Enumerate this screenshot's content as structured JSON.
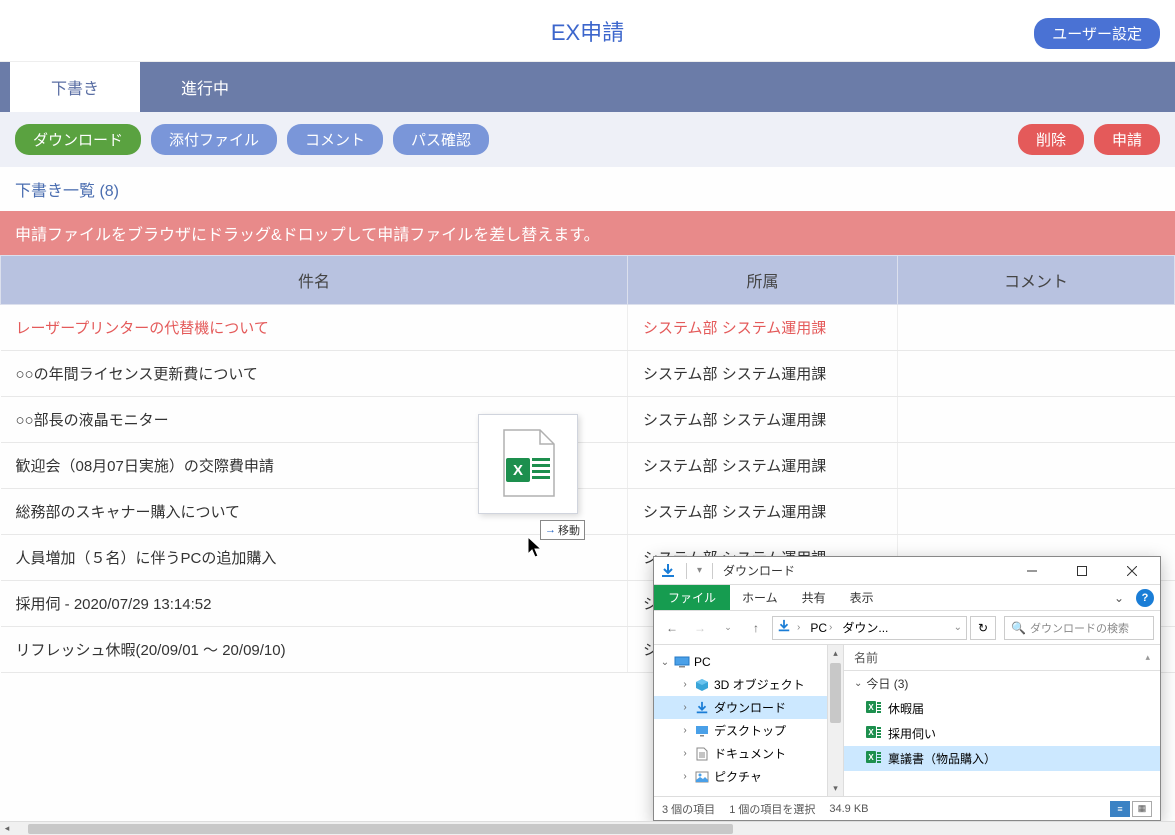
{
  "header": {
    "title": "EX申請",
    "user_settings": "ユーザー設定"
  },
  "tabs": {
    "draft": "下書き",
    "in_progress": "進行中"
  },
  "toolbar": {
    "download": "ダウンロード",
    "attachment": "添付ファイル",
    "comment": "コメント",
    "path_check": "パス確認",
    "delete": "削除",
    "apply": "申請"
  },
  "list_title": "下書き一覧 (8)",
  "banner": "申請ファイルをブラウザにドラッグ&ドロップして申請ファイルを差し替えます。",
  "columns": {
    "subject": "件名",
    "dept": "所属",
    "comment": "コメント"
  },
  "rows": [
    {
      "subject": "レーザープリンターの代替機について",
      "dept": "システム部 システム運用課",
      "comment": "",
      "highlighted": true
    },
    {
      "subject": "○○の年間ライセンス更新費について",
      "dept": "システム部 システム運用課",
      "comment": ""
    },
    {
      "subject": "○○部長の液晶モニター",
      "dept": "システム部 システム運用課",
      "comment": ""
    },
    {
      "subject": "歓迎会（08月07日実施）の交際費申請",
      "dept": "システム部 システム運用課",
      "comment": ""
    },
    {
      "subject": "総務部のスキャナー購入について",
      "dept": "システム部 システム運用課",
      "comment": ""
    },
    {
      "subject": "人員増加（５名）に伴うPCの追加購入",
      "dept": "システム部 システム運用課",
      "comment": ""
    },
    {
      "subject": "採用伺 - 2020/07/29 13:14:52",
      "dept": "シ",
      "comment": ""
    },
    {
      "subject": "リフレッシュ休暇(20/09/01 ～ 20/09/10)",
      "dept": "シ",
      "comment": ""
    }
  ],
  "drag": {
    "tooltip": "移動"
  },
  "explorer": {
    "title": "ダウンロード",
    "menu": {
      "file": "ファイル",
      "home": "ホーム",
      "share": "共有",
      "view": "表示"
    },
    "breadcrumb": {
      "pc": "PC",
      "downloads": "ダウン..."
    },
    "search_placeholder": "ダウンロードの検索",
    "tree": {
      "pc": "PC",
      "objects3d": "3D オブジェクト",
      "downloads": "ダウンロード",
      "desktop": "デスクトップ",
      "documents": "ドキュメント",
      "pictures": "ピクチャ"
    },
    "list": {
      "name_col": "名前",
      "group": "今日 (3)",
      "files": [
        "休暇届",
        "採用伺い",
        "稟議書（物品購入）"
      ]
    },
    "status": {
      "count": "3 個の項目",
      "selected": "1 個の項目を選択",
      "size": "34.9 KB"
    }
  }
}
